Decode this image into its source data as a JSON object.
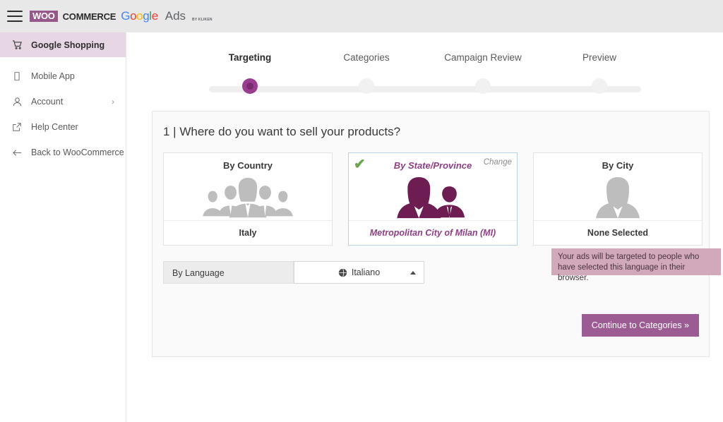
{
  "topbar": {
    "menu_icon": "hamburger-icon",
    "woo_badge": "WOO",
    "woo_word": "COMMERCE",
    "google_g1": "G",
    "google_o1": "o",
    "google_o2": "o",
    "google_g2": "g",
    "google_l": "l",
    "google_e": "e",
    "ads_word": "Ads",
    "ads_sub": "BY KLIKEN"
  },
  "sidebar": {
    "items": [
      {
        "label": "Google Shopping",
        "icon": "cart-icon",
        "active": true,
        "chevron": ""
      },
      {
        "label": "Mobile App",
        "icon": "mobile-icon",
        "active": false,
        "chevron": ""
      },
      {
        "label": "Account",
        "icon": "person-icon",
        "active": false,
        "chevron": "›"
      },
      {
        "label": "Help Center",
        "icon": "external-link-icon",
        "active": false,
        "chevron": ""
      },
      {
        "label": "Back to WooCommerce",
        "icon": "arrow-left-icon",
        "active": false,
        "chevron": ""
      }
    ]
  },
  "stepper": {
    "steps": [
      {
        "label": "Targeting",
        "state": "current"
      },
      {
        "label": "Categories",
        "state": "upcoming"
      },
      {
        "label": "Campaign Review",
        "state": "upcoming"
      },
      {
        "label": "Preview",
        "state": "upcoming"
      }
    ]
  },
  "panel": {
    "title": "1 | Where do you want to sell your products?",
    "cards": [
      {
        "heading": "By Country",
        "value": "Italy",
        "selected": false,
        "art": "crowd-of-people-icon",
        "change_label": ""
      },
      {
        "heading": "By State/Province",
        "value": "Metropolitan City of Milan (MI)",
        "selected": true,
        "art": "two-people-icon",
        "change_label": "Change",
        "check_icon": "green-check-icon"
      },
      {
        "heading": "By City",
        "value": "None Selected",
        "selected": false,
        "art": "single-person-icon",
        "change_label": ""
      }
    ],
    "language": {
      "label": "By Language",
      "selected_value": "Italiano",
      "icon": "globe-icon",
      "caret": "caret-up-icon"
    },
    "note": "Your ads will be targeted to people who have selected this language in their browser.",
    "continue_label": "Continue to Categories »"
  },
  "colors": {
    "brand_purple": "#96588a",
    "active_step": "#9b3d8f",
    "active_step_inner": "#7a2b70",
    "sidebar_active_bg": "#e7d7e4",
    "button_purple": "#9c5c93",
    "note_bg": "#d2a8bb",
    "check_green": "#6aa84f",
    "selected_card_border": "#b9d4ea",
    "selected_card_text": "#8e3f85",
    "art_gray": "#bdbdbd",
    "art_purple": "#6d1d52",
    "topbar_bg": "#e8e8e8",
    "panel_bg": "#fafafa"
  }
}
